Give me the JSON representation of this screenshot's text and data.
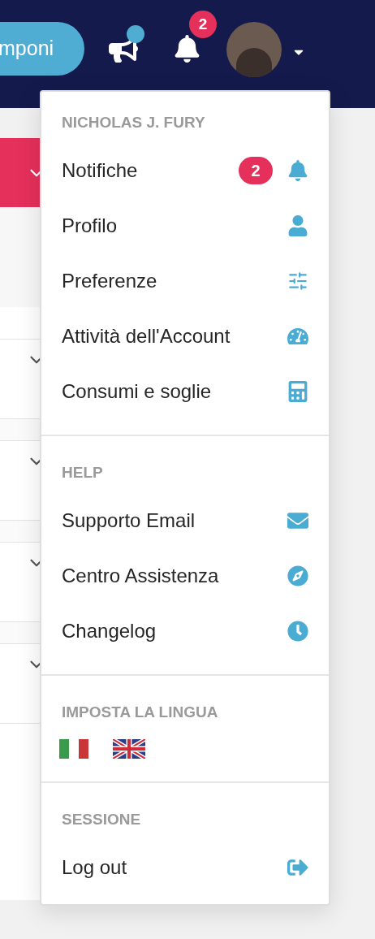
{
  "header": {
    "compose_button": {
      "label": "mponi"
    },
    "announcements": {
      "unread": true
    },
    "notifications": {
      "badge": "2"
    }
  },
  "user_menu": {
    "sections": [
      {
        "kind": "links",
        "title": "NICHOLAS J. FURY",
        "items": [
          {
            "label": "Notifiche",
            "badge": "2"
          },
          {
            "label": "Profilo"
          },
          {
            "label": "Preferenze"
          },
          {
            "label": "Attività dell'Account"
          },
          {
            "label": "Consumi e soglie"
          }
        ]
      },
      {
        "kind": "links",
        "title": "HELP",
        "items": [
          {
            "label": "Supporto Email"
          },
          {
            "label": "Centro Assistenza"
          },
          {
            "label": "Changelog"
          }
        ]
      },
      {
        "kind": "flags",
        "title": "IMPOSTA LA LINGUA"
      },
      {
        "kind": "links",
        "title": "SESSIONE",
        "items": [
          {
            "label": "Log out"
          }
        ]
      }
    ]
  }
}
